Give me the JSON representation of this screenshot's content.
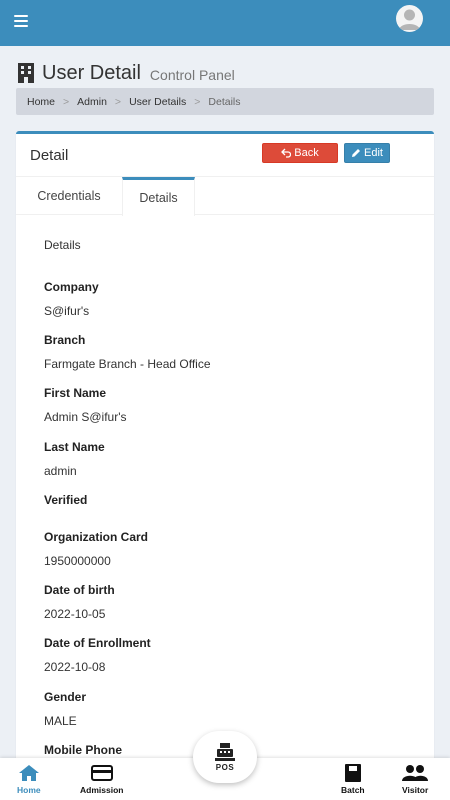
{
  "header": {
    "menu_icon": "hamburger-icon",
    "avatar_icon": "user-avatar-icon"
  },
  "page": {
    "title": "User Detail",
    "subtitle": "Control Panel",
    "title_icon": "building-icon"
  },
  "breadcrumb": [
    {
      "label": "Home"
    },
    {
      "label": "Admin"
    },
    {
      "label": "User Details"
    },
    {
      "label": "Details"
    }
  ],
  "box": {
    "title": "Detail",
    "back_label": "Back",
    "edit_label": "Edit",
    "colors": {
      "accent": "#3c8dbc",
      "danger": "#dd4b39"
    }
  },
  "tabs": [
    {
      "label": "Credentials",
      "active": false
    },
    {
      "label": "Details",
      "active": true
    }
  ],
  "details": {
    "section_title": "Details",
    "fields": [
      {
        "label": "Company",
        "value": "S@ifur's"
      },
      {
        "label": "Branch",
        "value": "Farmgate Branch - Head Office"
      },
      {
        "label": "First Name",
        "value": "Admin S@ifur's"
      },
      {
        "label": "Last Name",
        "value": "admin"
      },
      {
        "label": "Verified",
        "value": ""
      },
      {
        "label": "Organization Card",
        "value": "1950000000"
      },
      {
        "label": "Date of birth",
        "value": "2022-10-05"
      },
      {
        "label": "Date of Enrollment",
        "value": "2022-10-08"
      },
      {
        "label": "Gender",
        "value": "MALE"
      },
      {
        "label": "Mobile Phone",
        "value": ""
      }
    ]
  },
  "bottom_nav": {
    "home": "Home",
    "admission": "Admission",
    "pos": "POS",
    "batch": "Batch",
    "visitor": "Visitor"
  }
}
